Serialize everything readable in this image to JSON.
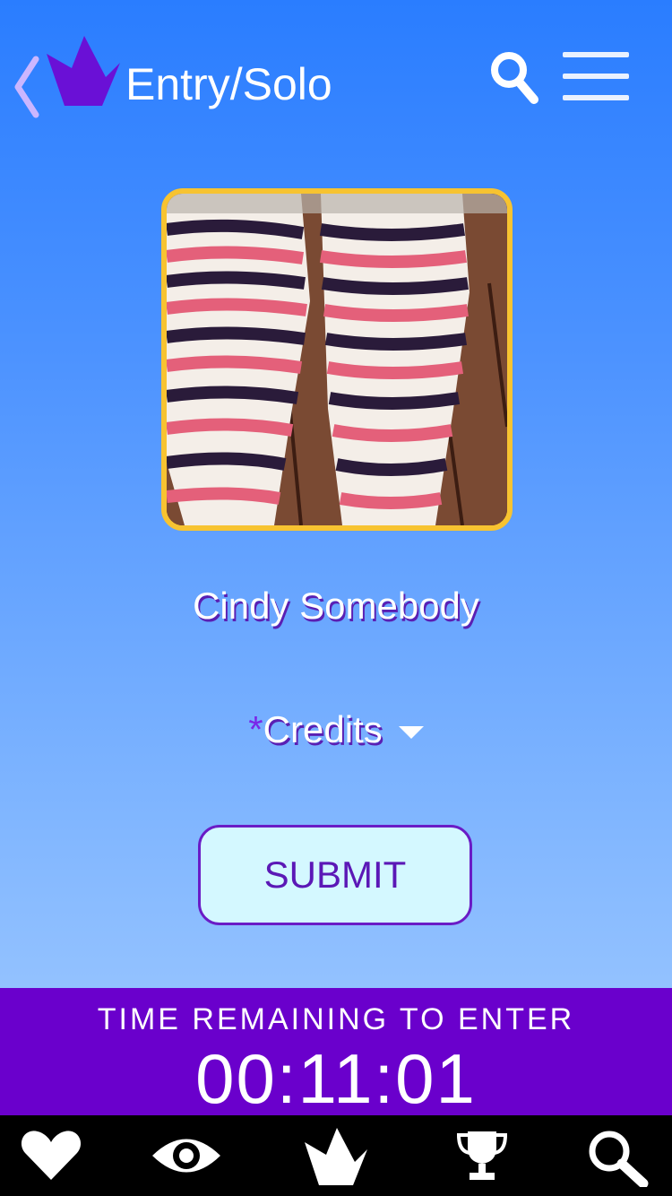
{
  "header": {
    "title": "Entry/Solo",
    "back_icon": "chevron-left-icon",
    "logo_icon": "crown-logo-icon",
    "search_icon": "search-icon",
    "menu_icon": "hamburger-menu-icon"
  },
  "entry": {
    "photo_alt": "striped-socks-photo",
    "name": "Cindy Somebody",
    "credits_asterisk": "*",
    "credits_label": "Credits",
    "submit_label": "SUBMIT"
  },
  "timer": {
    "label": "TIME REMAINING TO ENTER",
    "value": "00:11:01"
  },
  "nav": {
    "items": [
      {
        "icon": "heart-icon"
      },
      {
        "icon": "eye-icon"
      },
      {
        "icon": "crown-icon"
      },
      {
        "icon": "trophy-icon"
      },
      {
        "icon": "search-icon"
      }
    ]
  },
  "colors": {
    "accent": "#6a00cc",
    "photo_border": "#f7c331",
    "submit_bg": "#d4f8ff",
    "submit_text": "#5b18b6",
    "text_shadow": "#5a1fb3"
  }
}
